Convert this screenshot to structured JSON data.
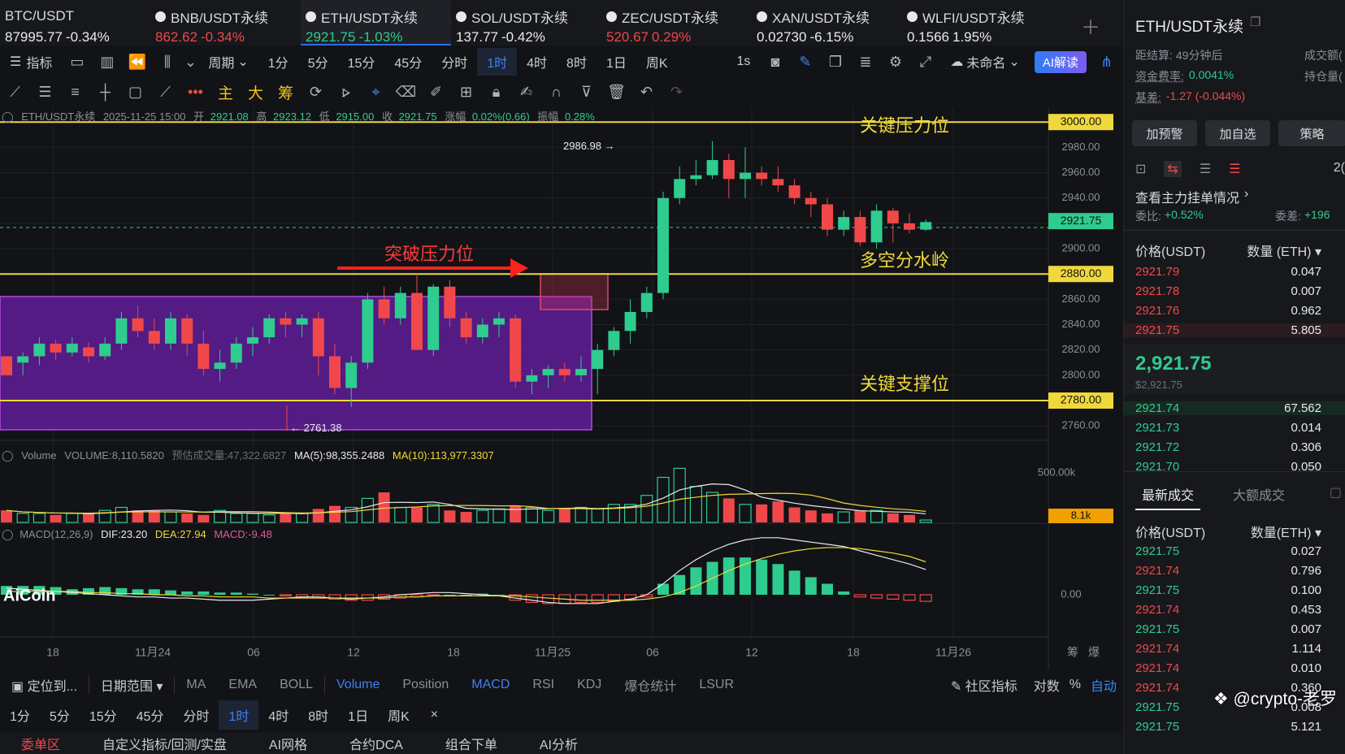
{
  "tickers": [
    {
      "name": "BTC/USDT",
      "price": "87995.77",
      "change": "-0.34%",
      "color": "wh"
    },
    {
      "name": "BNB/USDT永续",
      "price": "862.62",
      "change": "-0.34%",
      "color": "dn"
    },
    {
      "name": "ETH/USDT永续",
      "price": "2921.75",
      "change": "-1.03%",
      "color": "up",
      "active": true
    },
    {
      "name": "SOL/USDT永续",
      "price": "137.77",
      "change": "-0.42%",
      "color": "wh"
    },
    {
      "name": "ZEC/USDT永续",
      "price": "520.67",
      "change": "0.29%",
      "color": "dn"
    },
    {
      "name": "XAN/USDT永续",
      "price": "0.02730",
      "change": "-6.15%",
      "color": "wh"
    },
    {
      "name": "WLFI/USDT永续",
      "price": "0.1566",
      "change": "1.95%",
      "color": "wh"
    }
  ],
  "toolbar1": {
    "indicator": "指标",
    "period": "周期",
    "intervals": [
      "1分",
      "5分",
      "15分",
      "45分",
      "分时",
      "1时",
      "4时",
      "8时",
      "1日",
      "周K"
    ],
    "active": "1时",
    "sec": "1s",
    "unnamed": "未命名",
    "ai": "AI解读"
  },
  "toolbar2": {
    "main": "主",
    "big": "大",
    "chip": "筹"
  },
  "ohlc": {
    "symbol": "ETH/USDT永续",
    "time": "2025-11-25 15:00",
    "open_l": "开",
    "open": "2921.08",
    "high_l": "高",
    "high": "2923.12",
    "low_l": "低",
    "low": "2915.00",
    "close_l": "收",
    "close": "2921.75",
    "chg_l": "涨幅",
    "chg": "0.02%(0.66)",
    "amp_l": "振幅",
    "amp": "0.28%"
  },
  "annotations": {
    "resistance": "关键压力位",
    "pivot": "多空分水岭",
    "support": "关键支撑位",
    "breakout": "突破压力位",
    "high_mark": "2986.98",
    "low_mark": "2761.38"
  },
  "levels": [
    {
      "price": 3000,
      "label": "3000.00"
    },
    {
      "price": 2880,
      "label": "2880.00"
    },
    {
      "price": 2780,
      "label": "2780.00"
    }
  ],
  "current_price_label": "2921.75",
  "volume": {
    "label": "Volume",
    "value": "VOLUME:8,110.5820",
    "est": "预估成交量:47,322.6827",
    "ma5": "MA(5):98,355.2488",
    "ma10": "MA(10):113,977.3307",
    "axis": "500.00k",
    "last": "8.1k"
  },
  "macd": {
    "label": "MACD(12,26,9)",
    "dif": "DIF:23.20",
    "dea": "DEA:27.94",
    "macd": "MACD:-9.48",
    "zero": "0.00"
  },
  "xaxis": [
    "18",
    "11月24",
    "06",
    "12",
    "18",
    "11月25",
    "06",
    "12",
    "18",
    "11月26"
  ],
  "xaxis_right": [
    "筹",
    "爆"
  ],
  "watermark": "AiCoin",
  "chart_data": {
    "type": "candlestick",
    "y_ticks": [
      2980,
      2960,
      2940,
      2920,
      2900,
      2880,
      2860,
      2840,
      2820,
      2800,
      2780,
      2760
    ],
    "candles": [
      [
        2815,
        2800,
        2800,
        2815
      ],
      [
        2810,
        2815,
        2800,
        2818
      ],
      [
        2815,
        2825,
        2808,
        2830
      ],
      [
        2825,
        2818,
        2812,
        2828
      ],
      [
        2818,
        2825,
        2815,
        2830
      ],
      [
        2822,
        2815,
        2810,
        2826
      ],
      [
        2815,
        2825,
        2812,
        2830
      ],
      [
        2825,
        2845,
        2820,
        2850
      ],
      [
        2845,
        2835,
        2830,
        2855
      ],
      [
        2835,
        2825,
        2820,
        2845
      ],
      [
        2825,
        2845,
        2820,
        2850
      ],
      [
        2845,
        2825,
        2815,
        2848
      ],
      [
        2825,
        2805,
        2800,
        2835
      ],
      [
        2805,
        2810,
        2795,
        2820
      ],
      [
        2810,
        2825,
        2805,
        2830
      ],
      [
        2825,
        2830,
        2815,
        2838
      ],
      [
        2830,
        2845,
        2825,
        2848
      ],
      [
        2845,
        2840,
        2830,
        2850
      ],
      [
        2840,
        2845,
        2830,
        2848
      ],
      [
        2845,
        2815,
        2800,
        2850
      ],
      [
        2815,
        2790,
        2785,
        2825
      ],
      [
        2790,
        2810,
        2775,
        2815
      ],
      [
        2810,
        2860,
        2805,
        2865
      ],
      [
        2860,
        2845,
        2840,
        2870
      ],
      [
        2845,
        2865,
        2840,
        2870
      ],
      [
        2865,
        2820,
        2820,
        2880
      ],
      [
        2820,
        2870,
        2815,
        2872
      ],
      [
        2870,
        2845,
        2838,
        2875
      ],
      [
        2845,
        2830,
        2825,
        2850
      ],
      [
        2830,
        2840,
        2825,
        2845
      ],
      [
        2840,
        2845,
        2830,
        2850
      ],
      [
        2845,
        2795,
        2790,
        2848
      ],
      [
        2795,
        2800,
        2785,
        2805
      ],
      [
        2800,
        2805,
        2790,
        2808
      ],
      [
        2805,
        2800,
        2795,
        2810
      ],
      [
        2800,
        2805,
        2795,
        2815
      ],
      [
        2805,
        2820,
        2785,
        2825
      ],
      [
        2820,
        2835,
        2815,
        2838
      ],
      [
        2835,
        2850,
        2825,
        2860
      ],
      [
        2850,
        2865,
        2845,
        2870
      ],
      [
        2865,
        2940,
        2860,
        2945
      ],
      [
        2940,
        2955,
        2935,
        2965
      ],
      [
        2955,
        2958,
        2950,
        2970
      ],
      [
        2958,
        2970,
        2955,
        2985
      ],
      [
        2970,
        2955,
        2940,
        2975
      ],
      [
        2955,
        2960,
        2940,
        2980
      ],
      [
        2960,
        2955,
        2950,
        2965
      ],
      [
        2955,
        2950,
        2945,
        2965
      ],
      [
        2950,
        2940,
        2935,
        2955
      ],
      [
        2940,
        2935,
        2925,
        2945
      ],
      [
        2935,
        2915,
        2910,
        2940
      ],
      [
        2915,
        2925,
        2910,
        2930
      ],
      [
        2925,
        2905,
        2902,
        2930
      ],
      [
        2905,
        2930,
        2900,
        2935
      ],
      [
        2930,
        2920,
        2905,
        2932
      ],
      [
        2920,
        2915,
        2912,
        2928
      ],
      [
        2915,
        2921,
        2914,
        2923
      ]
    ],
    "volume": [
      40,
      30,
      30,
      25,
      30,
      30,
      40,
      50,
      40,
      40,
      35,
      30,
      25,
      40,
      30,
      30,
      25,
      30,
      30,
      45,
      55,
      50,
      80,
      100,
      50,
      50,
      60,
      40,
      35,
      40,
      45,
      55,
      50,
      40,
      45,
      50,
      45,
      60,
      60,
      90,
      150,
      180,
      120,
      100,
      80,
      60,
      60,
      70,
      50,
      40,
      30,
      35,
      40,
      40,
      30,
      25,
      8
    ],
    "macd_hist": [
      8,
      8,
      8,
      7,
      5,
      6,
      7,
      6,
      5,
      5,
      4,
      3,
      3,
      2,
      2,
      1,
      0,
      -1,
      -2,
      -3,
      -4,
      -5,
      -5,
      -4,
      -3,
      -2,
      -1,
      0,
      0,
      1,
      0,
      -5,
      -7,
      -8,
      -8,
      -7,
      -7,
      -6,
      -4,
      -2,
      10,
      18,
      25,
      30,
      34,
      34,
      32,
      28,
      22,
      16,
      10,
      3,
      -2,
      -3,
      -4,
      -5,
      -6
    ],
    "macd_dif": [
      6,
      5,
      4,
      3,
      2,
      1,
      0,
      -1,
      -2,
      -2,
      -3,
      -3,
      -4,
      -5,
      -5,
      -5,
      -4,
      -3,
      -2,
      -2,
      -3,
      -4,
      -3,
      -2,
      0,
      1,
      2,
      2,
      1,
      0,
      -1,
      -3,
      -5,
      -7,
      -8,
      -8,
      -8,
      -6,
      -4,
      0,
      10,
      22,
      32,
      40,
      46,
      50,
      52,
      52,
      50,
      48,
      46,
      44,
      40,
      36,
      32,
      28,
      23
    ],
    "macd_dea": [
      3,
      3,
      3,
      3,
      3,
      2,
      2,
      1,
      1,
      0,
      0,
      -1,
      -1,
      -2,
      -2,
      -2,
      -3,
      -3,
      -3,
      -3,
      -3,
      -3,
      -3,
      -3,
      -2,
      -2,
      -1,
      -1,
      -1,
      -1,
      -1,
      -1,
      -2,
      -3,
      -4,
      -5,
      -5,
      -5,
      -5,
      -4,
      -2,
      2,
      8,
      15,
      22,
      28,
      33,
      37,
      40,
      42,
      43,
      43,
      42,
      40,
      38,
      35,
      30
    ]
  },
  "bottom": {
    "locate": "定位到...",
    "range": "日期范围",
    "ind": [
      "MA",
      "EMA",
      "BOLL",
      "Volume",
      "Position",
      "MACD",
      "RSI",
      "KDJ",
      "爆仓统计",
      "LSUR"
    ],
    "community": "社区指标",
    "log": "对数",
    "pct": "%",
    "auto": "自动"
  },
  "bottom2": [
    "1分",
    "5分",
    "15分",
    "45分",
    "分时",
    "1时",
    "4时",
    "8时",
    "1日",
    "周K"
  ],
  "bottom3": [
    "委单区",
    "自定义指标/回测/实盘",
    "AI网格",
    "合约DCA",
    "组合下单",
    "AI分析"
  ],
  "right": {
    "title": "ETH/USDT永续",
    "settle_l": "距结算:",
    "settle": "49分钟后",
    "vol_l": "成交额(",
    "fund_l": "资金费率:",
    "fund": "0.0041%",
    "oi_l": "持仓量(",
    "basis_l": "基差:",
    "basis": "-1.27 (-0.044%)",
    "btns": [
      "加预警",
      "加自选",
      "策略"
    ],
    "depth_link": "查看主力挂单情况",
    "ratio_l": "委比:",
    "ratio": "+0.52%",
    "diff_l": "委差:",
    "diff": "+196",
    "hdr_price": "价格(USDT)",
    "hdr_qty": "数量 (ETH)",
    "asks": [
      [
        "2921.79",
        "0.047"
      ],
      [
        "2921.78",
        "0.007"
      ],
      [
        "2921.76",
        "0.962"
      ],
      [
        "2921.75",
        "5.805"
      ]
    ],
    "mid": "2,921.75",
    "mid_usd": "$2,921.75",
    "bids": [
      [
        "2921.74",
        "67.562"
      ],
      [
        "2921.73",
        "0.014"
      ],
      [
        "2921.72",
        "0.306"
      ],
      [
        "2921.70",
        "0.050"
      ]
    ],
    "tabs": [
      "最新成交",
      "大额成交"
    ],
    "hdr_qty2": "数量(ETH)",
    "trades": [
      [
        "2921.75",
        "0.027",
        "up"
      ],
      [
        "2921.74",
        "0.796",
        "dn"
      ],
      [
        "2921.75",
        "0.100",
        "up"
      ],
      [
        "2921.74",
        "0.453",
        "dn"
      ],
      [
        "2921.75",
        "0.007",
        "up"
      ],
      [
        "2921.74",
        "1.114",
        "dn"
      ],
      [
        "2921.74",
        "0.010",
        "dn"
      ],
      [
        "2921.74",
        "0.360",
        "dn"
      ],
      [
        "2921.75",
        "0.008",
        "up"
      ],
      [
        "2921.75",
        "5.121",
        "up"
      ]
    ],
    "count": "2(",
    "credit": "@crypto-老罗"
  }
}
